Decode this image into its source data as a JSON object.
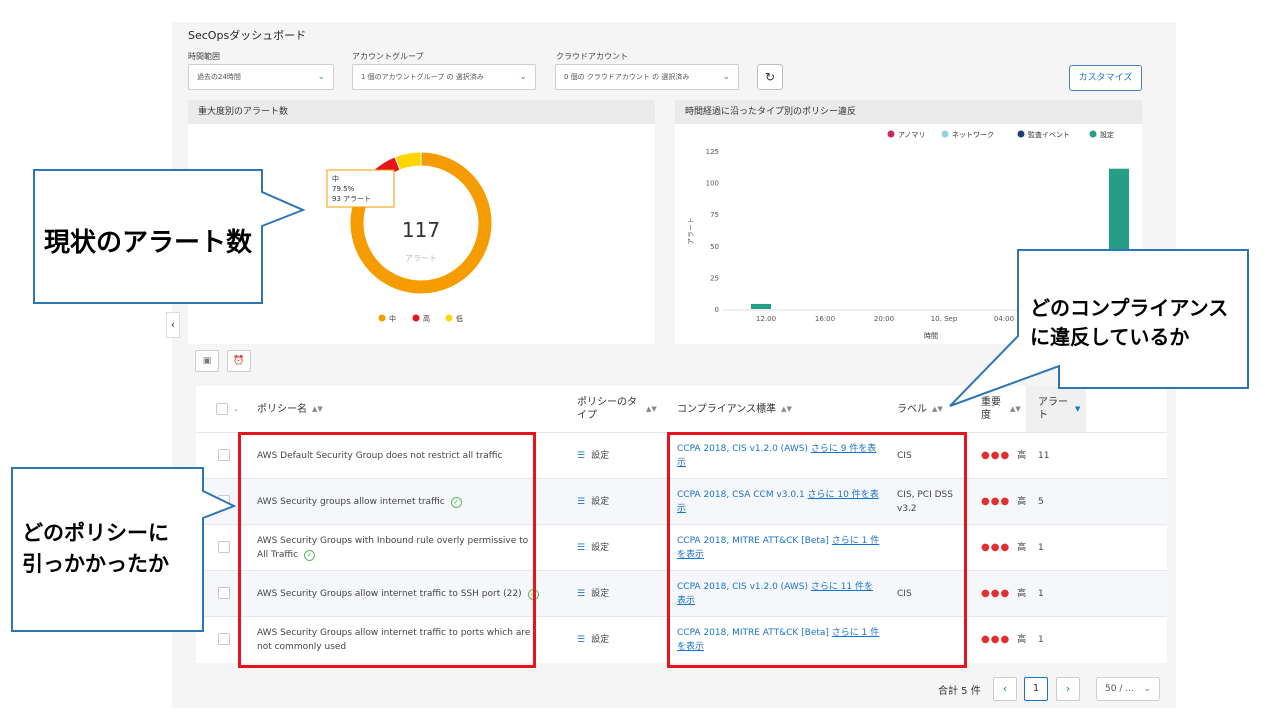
{
  "dashboard": {
    "title": "SecOpsダッシュボード",
    "filters": [
      {
        "label": "時間範囲",
        "value": "過去の24時間"
      },
      {
        "label": "アカウントグループ",
        "value": "1 個のアカウントグループ の 選択済み"
      },
      {
        "label": "クラウドアカウント",
        "value": "0 個の クラウドアカウント の 選択済み"
      }
    ],
    "customize_label": "カスタマイズ"
  },
  "alerts_panel": {
    "title": "重大度別のアラート数",
    "total": "117",
    "total_label": "アラート",
    "tooltip": {
      "name": "中",
      "percent": "79.5%",
      "count": "93 アラート"
    },
    "legend": [
      {
        "label": "中",
        "color": "#f59c00"
      },
      {
        "label": "高",
        "color": "#e8141b"
      },
      {
        "label": "低",
        "color": "#ffd500"
      }
    ]
  },
  "violations_panel": {
    "title": "時間経過に沿ったタイプ別のポリシー違反",
    "legend": [
      {
        "label": "アノマリ",
        "color": "#c9295f"
      },
      {
        "label": "ネットワーク",
        "color": "#8fd3de"
      },
      {
        "label": "監査イベント",
        "color": "#1c3f7a"
      },
      {
        "label": "設定",
        "color": "#259e85"
      }
    ]
  },
  "chart_data": [
    {
      "type": "pie",
      "categories": [
        "中",
        "高",
        "低"
      ],
      "values": [
        93,
        17,
        7
      ],
      "total": 117
    },
    {
      "type": "bar",
      "x_ticks": [
        "12:00",
        "16:00",
        "20:00",
        "10. Sep",
        "04:00"
      ],
      "xlabel": "時間",
      "ylabel": "アラート",
      "y_ticks": [
        "0",
        "25",
        "50",
        "75",
        "100",
        "125"
      ],
      "ylim": [
        0,
        125
      ],
      "bars": [
        {
          "label": "12:00",
          "series": "設定",
          "value": 4
        },
        {
          "label": "10. Sep",
          "series": "設定",
          "value": 111
        }
      ]
    }
  ],
  "table": {
    "headers": {
      "policy": "ポリシー名",
      "type": "ポリシーのタイプ",
      "compliance": "コンプライアンス標準",
      "label": "ラベル",
      "severity": "重要度",
      "alerts": "アラート"
    },
    "rows": [
      {
        "policy": "AWS Default Security Group does not restrict all traffic",
        "type": "設定",
        "compliance": "CCPA 2018, CIS v1.2.0 (AWS)",
        "more": "さらに 9 件を表示",
        "label": "CIS",
        "severity": "高",
        "alerts": "11",
        "check": false
      },
      {
        "policy": "AWS Security groups allow internet traffic",
        "type": "設定",
        "compliance": "CCPA 2018, CSA CCM v3.0.1",
        "more": "さらに 10 件を表示",
        "label": "CIS, PCI DSS v3.2",
        "severity": "高",
        "alerts": "5",
        "check": true
      },
      {
        "policy": "AWS Security Groups with Inbound rule overly permissive to All Traffic",
        "type": "設定",
        "compliance": "CCPA 2018, MITRE ATT&CK [Beta]",
        "more": "さらに 1 件を表示",
        "label": "",
        "severity": "高",
        "alerts": "1",
        "check": true
      },
      {
        "policy": "AWS Security Groups allow internet traffic to SSH port (22)",
        "type": "設定",
        "compliance": "CCPA 2018, CIS v1.2.0 (AWS)",
        "more": "さらに 11 件を表示",
        "label": "CIS",
        "severity": "高",
        "alerts": "1",
        "check": true
      },
      {
        "policy": "AWS Security Groups allow internet traffic to ports which are not commonly used",
        "type": "設定",
        "compliance": "CCPA 2018, MITRE ATT&CK [Beta]",
        "more": "さらに 1 件を表示",
        "label": "",
        "severity": "高",
        "alerts": "1",
        "check": false
      }
    ]
  },
  "pager": {
    "total": "合計 5 件",
    "page": "1",
    "per_page": "50 / ..."
  },
  "callouts": {
    "alerts": "現状のアラート数",
    "policy": "どのポリシーに\n引っかかったか",
    "compliance": "どのコンプライアンス\nに違反しているか"
  }
}
